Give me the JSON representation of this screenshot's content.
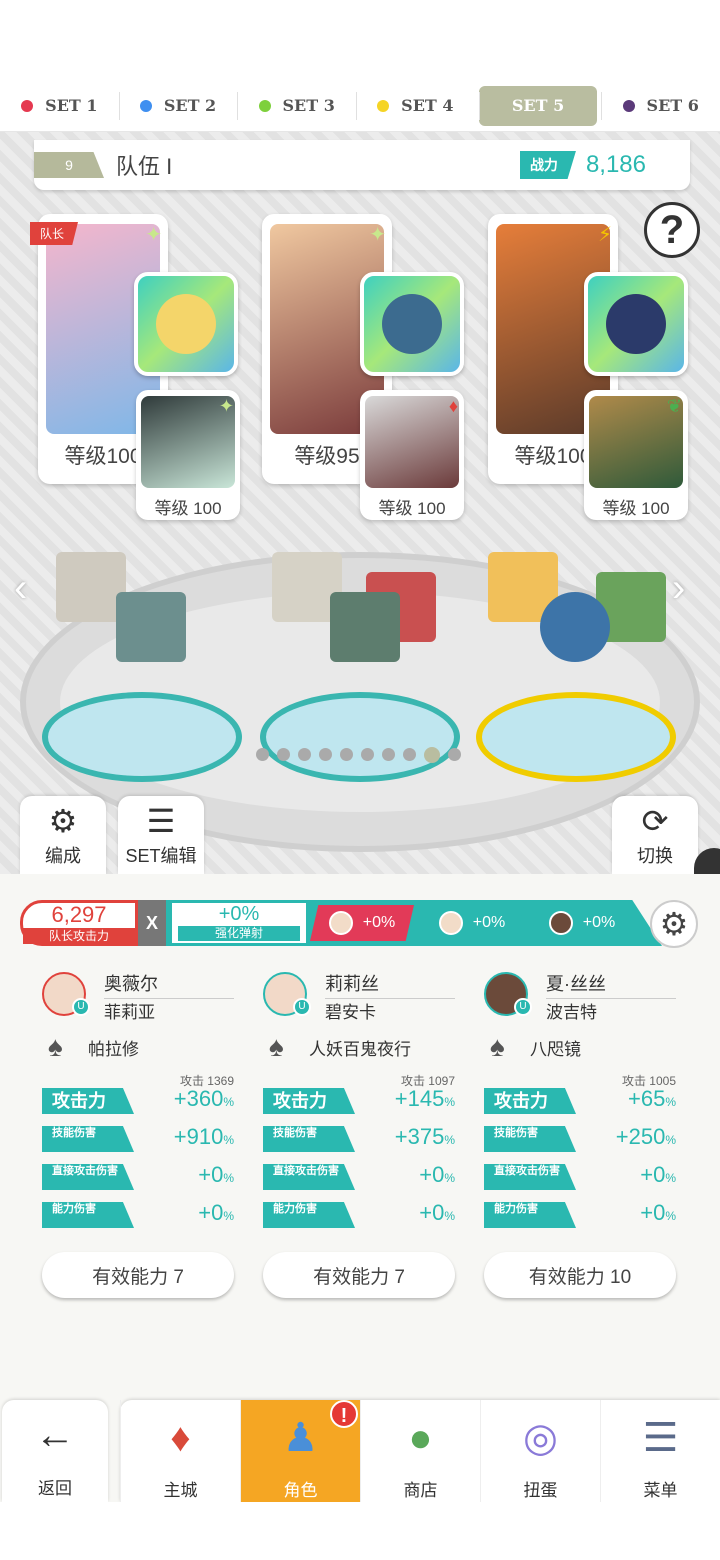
{
  "tabs": [
    {
      "label": "SET 1",
      "color": "#e53950"
    },
    {
      "label": "SET 2",
      "color": "#3f8ff0"
    },
    {
      "label": "SET 3",
      "color": "#7ed03c"
    },
    {
      "label": "SET 4",
      "color": "#f5d426"
    },
    {
      "label": "SET 5",
      "color": "#b9bda0"
    },
    {
      "label": "SET 6",
      "color": "#5b3a7a"
    }
  ],
  "team": {
    "number": "9",
    "name": "队伍 I",
    "power_label": "战力",
    "power_value": "8,186"
  },
  "cards": [
    {
      "level": "等级100",
      "leader": "队长",
      "sub_level": "等级 100"
    },
    {
      "level": "等级95",
      "sub_level": "等级 100"
    },
    {
      "level": "等级100",
      "sub_level": "等级 100"
    }
  ],
  "help": "?",
  "pager": {
    "count": 10,
    "active": 8
  },
  "buttons": {
    "formation": "编成",
    "set_edit": "SET编辑",
    "switch": "切换"
  },
  "bonus": {
    "leader_atk_value": "6,297",
    "leader_atk_label": "队长攻击力",
    "x": "X",
    "boost_value": "+0%",
    "boost_label": "强化弹射",
    "chips": [
      "+0%",
      "+0%",
      "+0%"
    ]
  },
  "chars": [
    {
      "name": "奥薇尔",
      "sub": "菲莉亚",
      "weapon": "帕拉修",
      "base": "攻击 1369",
      "atk_label": "攻击力",
      "atk": "+360",
      "skill_label": "技能伤害",
      "skill": "+910",
      "direct_label": "直接攻击伤害",
      "direct": "+0",
      "power_label": "能力伤害",
      "power": "+0",
      "ability": "有效能力 7"
    },
    {
      "name": "莉莉丝",
      "sub": "碧安卡",
      "weapon": "人妖百鬼夜行",
      "base": "攻击 1097",
      "atk_label": "攻击力",
      "atk": "+145",
      "skill_label": "技能伤害",
      "skill": "+375",
      "direct_label": "直接攻击伤害",
      "direct": "+0",
      "power_label": "能力伤害",
      "power": "+0",
      "ability": "有效能力 7"
    },
    {
      "name": "夏·丝丝",
      "sub": "波吉特",
      "weapon": "八咫镜",
      "base": "攻击 1005",
      "atk_label": "攻击力",
      "atk": "+65",
      "skill_label": "技能伤害",
      "skill": "+250",
      "direct_label": "直接攻击伤害",
      "direct": "+0",
      "power_label": "能力伤害",
      "power": "+0",
      "ability": "有效能力 10"
    }
  ],
  "percent": "%",
  "nav": {
    "back": "返回",
    "items": [
      "主城",
      "角色",
      "商店",
      "扭蛋",
      "菜单"
    ],
    "active": "角色",
    "alert": "!"
  }
}
